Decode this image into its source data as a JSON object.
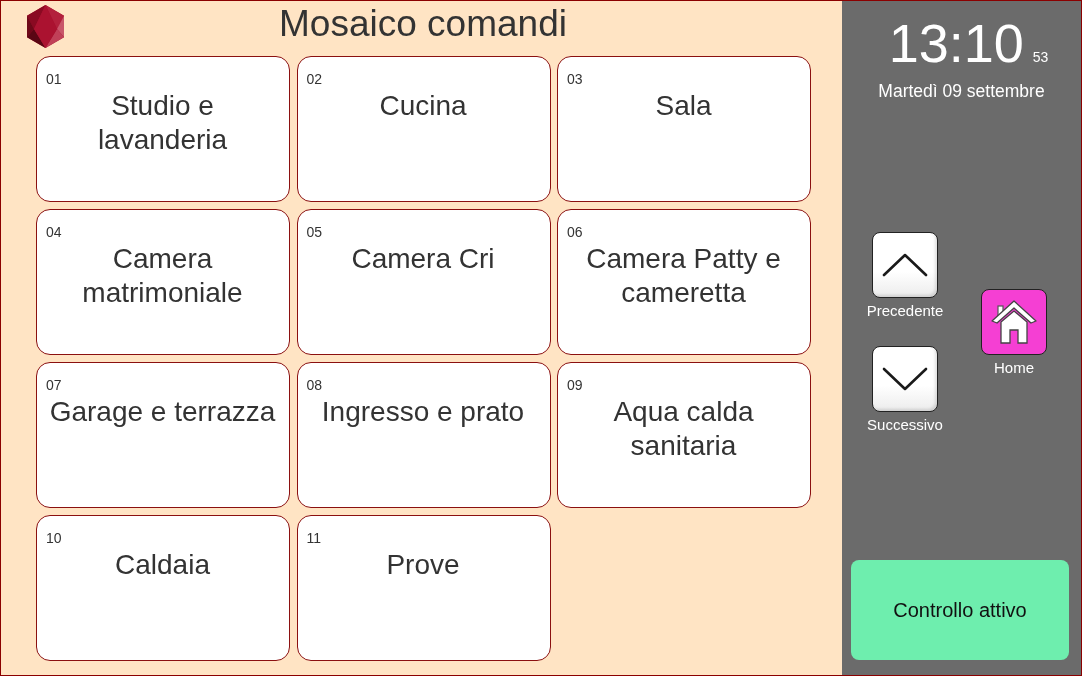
{
  "header": {
    "title": "Mosaico comandi"
  },
  "tiles": [
    {
      "number": "01",
      "name": "Studio e lavanderia"
    },
    {
      "number": "02",
      "name": "Cucina"
    },
    {
      "number": "03",
      "name": "Sala"
    },
    {
      "number": "04",
      "name": "Camera matrimoniale"
    },
    {
      "number": "05",
      "name": "Camera Cri"
    },
    {
      "number": "06",
      "name": "Camera Patty e cameretta"
    },
    {
      "number": "07",
      "name": "Garage e terrazza"
    },
    {
      "number": "08",
      "name": "Ingresso e prato"
    },
    {
      "number": "09",
      "name": "Aqua calda sanitaria"
    },
    {
      "number": "10",
      "name": "Caldaia"
    },
    {
      "number": "11",
      "name": "Prove"
    }
  ],
  "clock": {
    "time": "13:10",
    "seconds": "53",
    "date": "Martedì 09 settembre"
  },
  "navigation": [
    {
      "kind": "up",
      "label": "Precedente"
    },
    {
      "kind": "down",
      "label": "Successivo"
    }
  ],
  "home_button": {
    "label": "Home"
  },
  "status_button": {
    "label": "Controllo attivo"
  }
}
